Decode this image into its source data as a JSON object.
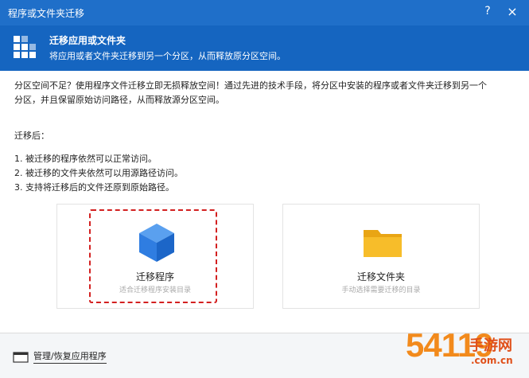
{
  "window": {
    "title": "程序或文件夹迁移",
    "help_label": "?",
    "close_label": "×"
  },
  "banner": {
    "title": "迁移应用或文件夹",
    "subtitle": "将应用或者文件夹迁移到另一个分区，从而释放原分区空间。"
  },
  "intro": {
    "line1": "分区空间不足？使用程序文件迁移立即无损释放空间！通过先进的技术手段，将分区中安装的程序或者文件夹迁移到另一个",
    "line2": "分区，并且保留原始访问路径，从而释放源分区空间。"
  },
  "after": {
    "heading": "迁移后：",
    "items": [
      "1. 被迁移的程序依然可以正常访问。",
      "2. 被迁移的文件夹依然可以用源路径访问。",
      "3. 支持将迁移后的文件还原到原始路径。"
    ]
  },
  "cards": [
    {
      "title": "迁移程序",
      "subtitle": "适合迁移程序安装目录",
      "icon": "cube-icon",
      "color": "#2f7de1"
    },
    {
      "title": "迁移文件夹",
      "subtitle": "手动选择需要迁移的目录",
      "icon": "folder-icon",
      "color": "#f5b51a"
    }
  ],
  "footer": {
    "manage_label": "管理/恢复应用程序"
  },
  "watermark": {
    "big": "54119",
    "cn": "手游网",
    "domain": ".com.cn"
  },
  "colors": {
    "titlebar": "#1f6fc9",
    "banner": "#1565c0",
    "highlight": "#d32020"
  }
}
